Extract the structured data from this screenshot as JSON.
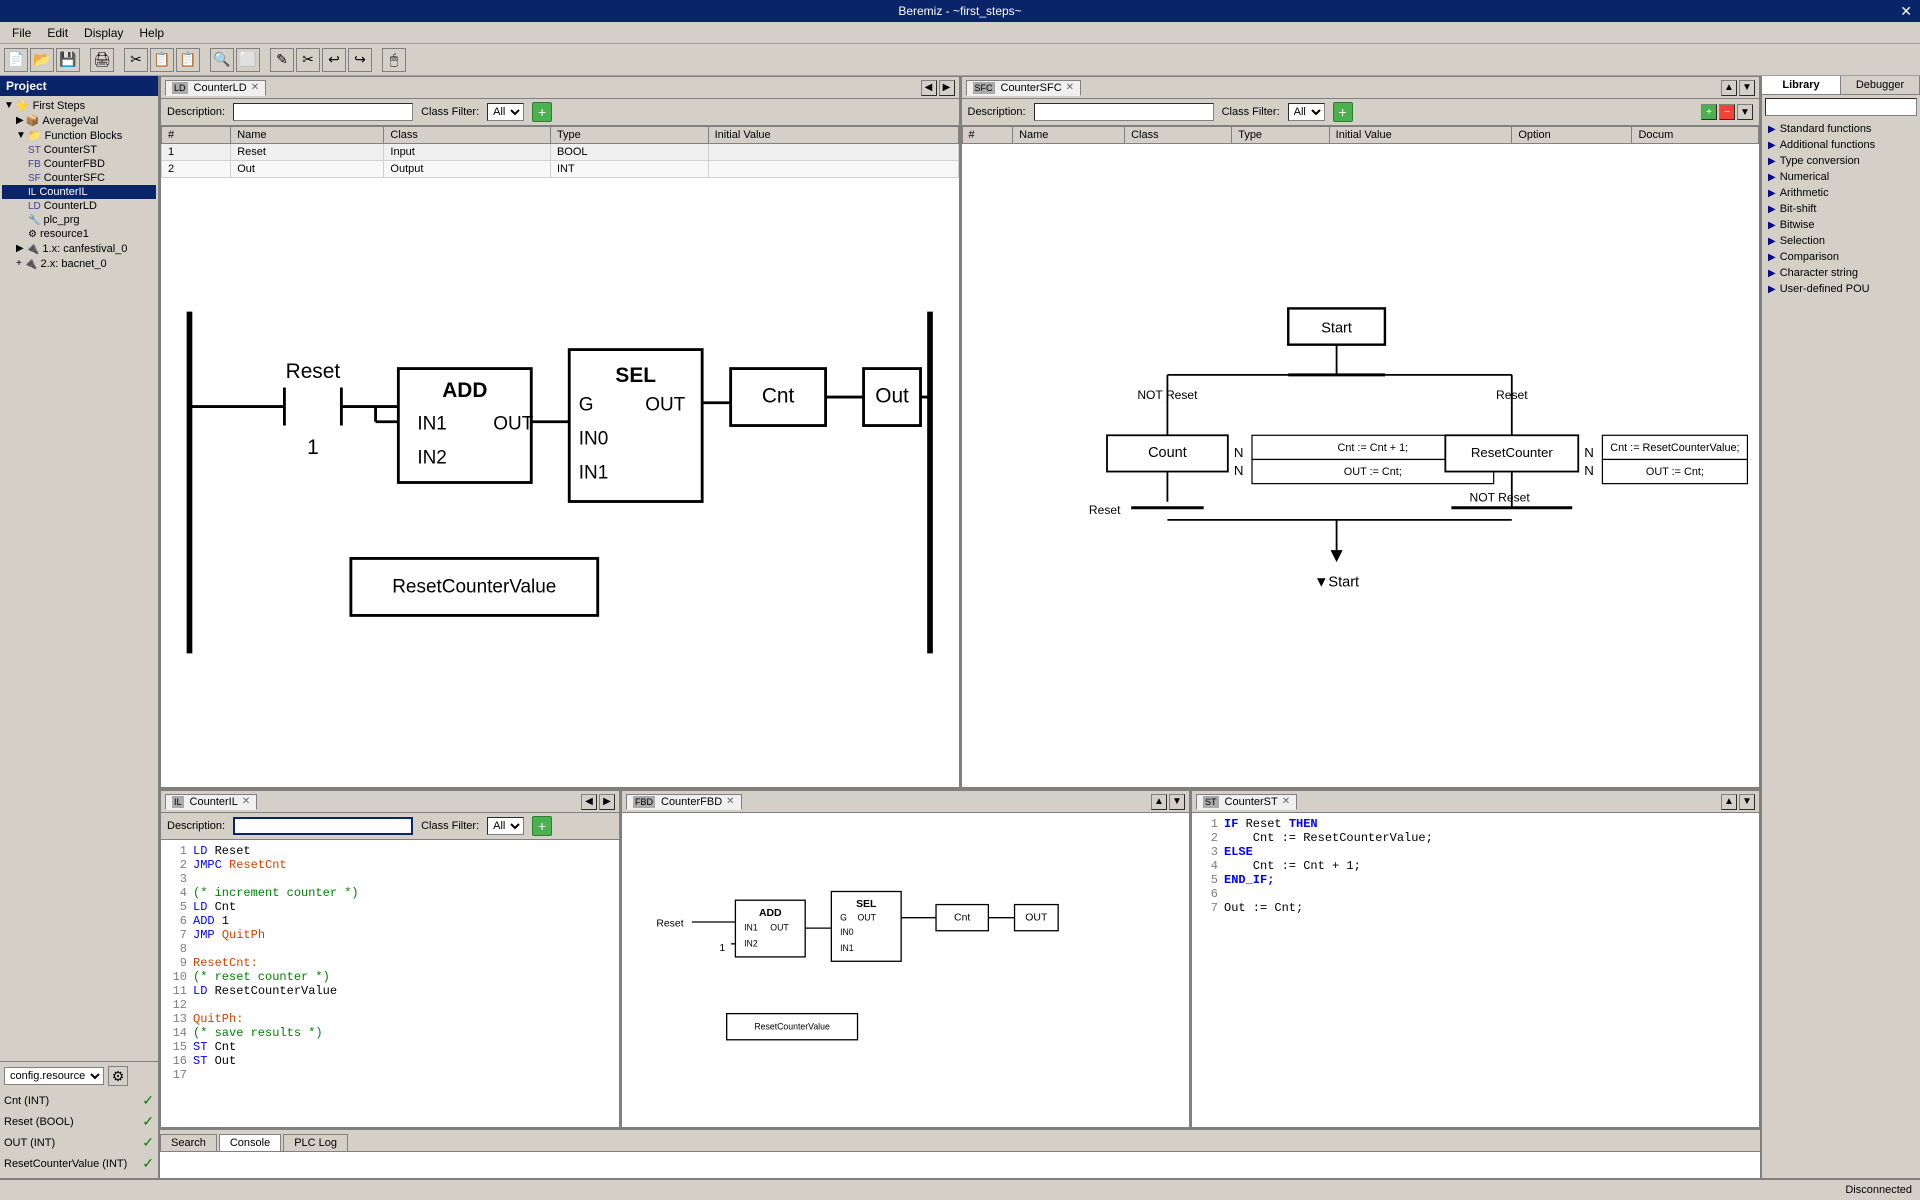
{
  "titlebar": {
    "title": "Beremiz - ~first_steps~",
    "close_label": "✕"
  },
  "menubar": {
    "items": [
      "File",
      "Edit",
      "Display",
      "Help"
    ]
  },
  "toolbar": {
    "buttons": [
      "📄",
      "📂",
      "💾",
      "🖨",
      "✂",
      "📋",
      "📋",
      "🔍",
      "⬜",
      "✎",
      "✂",
      "↩",
      "↪",
      "🖱"
    ]
  },
  "project": {
    "header": "Project",
    "tree": [
      {
        "label": "First Steps",
        "indent": 0,
        "icon": "▼",
        "type": "root"
      },
      {
        "label": "AverageVal",
        "indent": 1,
        "icon": "▶",
        "type": "fb"
      },
      {
        "label": "Function Blocks",
        "indent": 1,
        "icon": "▼",
        "type": "folder"
      },
      {
        "label": "CounterST",
        "indent": 2,
        "icon": "■",
        "type": "st"
      },
      {
        "label": "CounterFBD",
        "indent": 2,
        "icon": "■",
        "type": "fbd"
      },
      {
        "label": "CounterSFC",
        "indent": 2,
        "icon": "■",
        "type": "sfc"
      },
      {
        "label": "CounterIL",
        "indent": 2,
        "icon": "■",
        "type": "il",
        "selected": true
      },
      {
        "label": "CounterLD",
        "indent": 2,
        "icon": "■",
        "type": "ld"
      },
      {
        "label": "plc_prg",
        "indent": 2,
        "icon": "■",
        "type": "prg"
      },
      {
        "label": "resource1",
        "indent": 2,
        "icon": "■",
        "type": "res"
      },
      {
        "label": "1.x: canfestival_0",
        "indent": 1,
        "icon": "▶",
        "type": "can"
      },
      {
        "label": "2.x: bacnet_0",
        "indent": 1,
        "icon": "+",
        "type": "bacnet"
      }
    ]
  },
  "config": {
    "label": "config.resource",
    "vars": [
      {
        "name": "Cnt (INT)",
        "checked": true
      },
      {
        "name": "Reset (BOOL)",
        "checked": true
      },
      {
        "name": "OUT (INT)",
        "checked": true
      },
      {
        "name": "ResetCounterValue (INT)",
        "checked": true
      }
    ]
  },
  "panels": {
    "counter_ld": {
      "tab": "CounterLD",
      "icon": "LD",
      "description_label": "Description:",
      "class_filter_label": "Class Filter:",
      "class_filter_value": "All",
      "variables": [
        {
          "num": 1,
          "name": "Reset",
          "class": "Input",
          "type": "BOOL",
          "initial": ""
        },
        {
          "num": 2,
          "name": "Out",
          "class": "Output",
          "type": "INT",
          "initial": ""
        }
      ],
      "columns": [
        "#",
        "Name",
        "Class",
        "Type",
        "Initial Value"
      ]
    },
    "counter_sfc": {
      "tab": "CounterSFC",
      "icon": "SFC",
      "description_label": "Description:",
      "class_filter_label": "Class Filter:",
      "class_filter_value": "All",
      "columns": [
        "#",
        "Name",
        "Class",
        "Type",
        "Initial Value",
        "Option",
        "Docum"
      ]
    },
    "counter_il": {
      "tab": "CounterIL",
      "icon": "IL",
      "description_label": "Description:",
      "class_filter_label": "Class Filter:",
      "class_filter_value": "All",
      "lines": [
        {
          "num": 1,
          "code": "LD Reset",
          "type": "normal"
        },
        {
          "num": 2,
          "code": "JMPC ResetCnt",
          "type": "normal"
        },
        {
          "num": 3,
          "code": "",
          "type": "normal"
        },
        {
          "num": 4,
          "code": "(* increment counter *)",
          "type": "comment"
        },
        {
          "num": 5,
          "code": "LD Cnt",
          "type": "normal"
        },
        {
          "num": 6,
          "code": "ADD 1",
          "type": "normal"
        },
        {
          "num": 7,
          "code": "JMP QuitPh",
          "type": "normal"
        },
        {
          "num": 8,
          "code": "",
          "type": "normal"
        },
        {
          "num": 9,
          "code": "ResetCnt:",
          "type": "label"
        },
        {
          "num": 10,
          "code": "(* reset counter *)",
          "type": "comment"
        },
        {
          "num": 11,
          "code": "LD ResetCounterValue",
          "type": "normal"
        },
        {
          "num": 12,
          "code": "",
          "type": "normal"
        },
        {
          "num": 13,
          "code": "QuitPh:",
          "type": "label"
        },
        {
          "num": 14,
          "code": "(* save results *)",
          "type": "comment"
        },
        {
          "num": 15,
          "code": "ST Cnt",
          "type": "normal"
        },
        {
          "num": 16,
          "code": "ST Out",
          "type": "normal"
        },
        {
          "num": 17,
          "code": "",
          "type": "normal"
        }
      ]
    },
    "counter_fbd": {
      "tab": "CounterFBD",
      "icon": "FBD"
    },
    "counter_st": {
      "tab": "CounterST",
      "icon": "ST",
      "lines": [
        {
          "num": 1,
          "code": "IF Reset THEN",
          "type": "kw"
        },
        {
          "num": 2,
          "code": "    Cnt := ResetCounterValue;",
          "type": "normal"
        },
        {
          "num": 3,
          "code": "ELSE",
          "type": "kw"
        },
        {
          "num": 4,
          "code": "    Cnt := Cnt + 1;",
          "type": "normal"
        },
        {
          "num": 5,
          "code": "END_IF;",
          "type": "kw"
        },
        {
          "num": 6,
          "code": "",
          "type": "normal"
        },
        {
          "num": 7,
          "code": "Out := Cnt;",
          "type": "normal"
        }
      ]
    }
  },
  "library": {
    "tabs": [
      "Library",
      "Debugger"
    ],
    "active_tab": "Library",
    "search_placeholder": "",
    "items": [
      {
        "label": "Standard functions",
        "arrow": "▶"
      },
      {
        "label": "Additional functions",
        "arrow": "▶"
      },
      {
        "label": "Type conversion",
        "arrow": "▶"
      },
      {
        "label": "Numerical",
        "arrow": "▶"
      },
      {
        "label": "Arithmetic",
        "arrow": "▶"
      },
      {
        "label": "Bit-shift",
        "arrow": "▶"
      },
      {
        "label": "Bitwise",
        "arrow": "▶"
      },
      {
        "label": "Selection",
        "arrow": "▶"
      },
      {
        "label": "Comparison",
        "arrow": "▶"
      },
      {
        "label": "Character string",
        "arrow": "▶"
      },
      {
        "label": "User-defined POU",
        "arrow": "▶"
      }
    ]
  },
  "bottom_tabs": {
    "tabs": [
      "Search",
      "Console",
      "PLC Log"
    ],
    "active_tab": "Console"
  },
  "statusbar": {
    "status": "Disconnected"
  },
  "sfc_diagram": {
    "start_label": "Start",
    "count_label": "Count",
    "reset_label": "Reset",
    "not_reset_label": "NOT Reset",
    "reset_counter_label": "ResetCounter",
    "cnt_increment": "Cnt := Cnt + 1;",
    "out_cnt": "OUT := Cnt;",
    "cnt_reset": "Cnt := ResetCounterValue;",
    "out_cnt2": "OUT := Cnt;",
    "start_bottom": "▼Start"
  }
}
